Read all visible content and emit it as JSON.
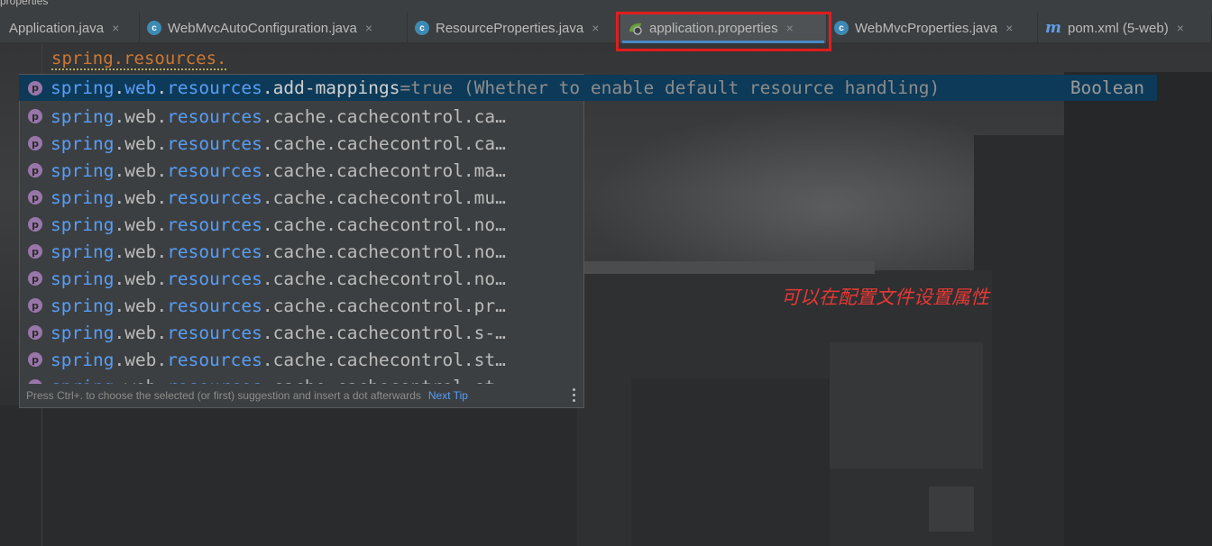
{
  "window": {
    "title_fragment": "properties"
  },
  "tabs": [
    {
      "label": "Application.java",
      "icon": "none",
      "active": false
    },
    {
      "label": "WebMvcAutoConfiguration.java",
      "icon": "class-icon",
      "active": false
    },
    {
      "label": "ResourceProperties.java",
      "icon": "class-icon",
      "active": false
    },
    {
      "label": "application.properties",
      "icon": "spring-properties-icon",
      "active": true
    },
    {
      "label": "WebMvcProperties.java",
      "icon": "class-icon",
      "active": false
    },
    {
      "label": "pom.xml (5-web)",
      "icon": "maven-icon",
      "active": false
    }
  ],
  "tab_close_glyph": "×",
  "class_icon_letter": "c",
  "maven_icon_letter": "m",
  "editor": {
    "typed_text": "spring.resources."
  },
  "completion": {
    "icon_letter": "p",
    "selected": {
      "prefix_a": "spring",
      "dot1": ".",
      "prefix_b": "web",
      "dot2": ".",
      "prefix_c": "resources",
      "dot3": ".",
      "suffix": "add-mappings",
      "default": "=true",
      "description": "(Whether to enable default resource handling)",
      "type": "Boolean"
    },
    "items": [
      {
        "suffix": "cache.cachecontrol.ca…"
      },
      {
        "suffix": "cache.cachecontrol.ca…"
      },
      {
        "suffix": "cache.cachecontrol.ma…"
      },
      {
        "suffix": "cache.cachecontrol.mu…"
      },
      {
        "suffix": "cache.cachecontrol.no…"
      },
      {
        "suffix": "cache.cachecontrol.no…"
      },
      {
        "suffix": "cache.cachecontrol.no…"
      },
      {
        "suffix": "cache.cachecontrol.pr…"
      },
      {
        "suffix": "cache.cachecontrol.s-…"
      },
      {
        "suffix": "cache.cachecontrol.st…"
      },
      {
        "suffix": "cache.cachecontrol.st…"
      }
    ],
    "row_prefix": {
      "a": "spring",
      "dot": ".",
      "b": "web",
      "c": "resources"
    },
    "footer": {
      "hint": "Press Ctrl+. to choose the selected (or first) suggestion and insert a dot afterwards",
      "next_tip": "Next Tip"
    }
  },
  "annotation": {
    "text": "可以在配置文件设置属性"
  },
  "colors": {
    "highlight_box": "#e01d1d",
    "annotation": "#e53935",
    "keyword_orange": "#cc7832",
    "link_blue": "#589df6",
    "selection": "#0d3a58"
  }
}
